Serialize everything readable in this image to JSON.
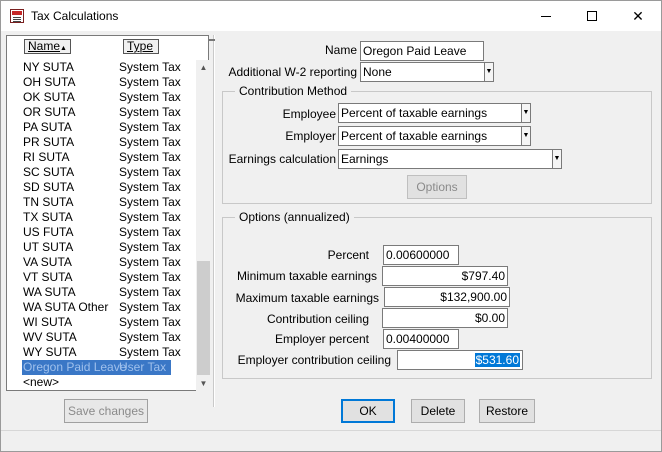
{
  "window": {
    "title": "Tax Calculations"
  },
  "list": {
    "col_name": "Name",
    "col_type": "Type",
    "rows": [
      {
        "name": "NY SUTA",
        "type": "System Tax"
      },
      {
        "name": "OH SUTA",
        "type": "System Tax"
      },
      {
        "name": "OK SUTA",
        "type": "System Tax"
      },
      {
        "name": "OR SUTA",
        "type": "System Tax"
      },
      {
        "name": "PA SUTA",
        "type": "System Tax"
      },
      {
        "name": "PR SUTA",
        "type": "System Tax"
      },
      {
        "name": "RI SUTA",
        "type": "System Tax"
      },
      {
        "name": "SC SUTA",
        "type": "System Tax"
      },
      {
        "name": "SD SUTA",
        "type": "System Tax"
      },
      {
        "name": "TN SUTA",
        "type": "System Tax"
      },
      {
        "name": "TX SUTA",
        "type": "System Tax"
      },
      {
        "name": "US FUTA",
        "type": "System Tax"
      },
      {
        "name": "UT SUTA",
        "type": "System Tax"
      },
      {
        "name": "VA SUTA",
        "type": "System Tax"
      },
      {
        "name": "VT SUTA",
        "type": "System Tax"
      },
      {
        "name": "WA SUTA",
        "type": "System Tax"
      },
      {
        "name": "WA SUTA Other",
        "type": "System Tax"
      },
      {
        "name": "WI SUTA",
        "type": "System Tax"
      },
      {
        "name": "WV SUTA",
        "type": "System Tax"
      },
      {
        "name": "WY SUTA",
        "type": "System Tax"
      },
      {
        "name": "Oregon Paid Leave",
        "type": "User Tax"
      }
    ],
    "new_item": "<new>",
    "save_button": "Save changes"
  },
  "form": {
    "name_label": "Name",
    "name_value": "Oregon Paid Leave",
    "w2_label": "Additional W-2 reporting",
    "w2_value": "None",
    "contribution": {
      "title": "Contribution Method",
      "employee_label": "Employee",
      "employee_value": "Percent of taxable earnings",
      "employer_label": "Employer",
      "employer_value": "Percent of taxable earnings",
      "earnings_label": "Earnings calculation",
      "earnings_value": "Earnings",
      "options_button": "Options"
    },
    "options": {
      "title": "Options (annualized)",
      "percent_label": "Percent",
      "percent_value": "0.00600000",
      "min_label": "Minimum taxable earnings",
      "min_value": "$797.40",
      "max_label": "Maximum taxable earnings",
      "max_value": "$132,900.00",
      "ceiling_label": "Contribution ceiling",
      "ceiling_value": "$0.00",
      "emp_pct_label": "Employer percent",
      "emp_pct_value": "0.00400000",
      "emp_ceiling_label": "Employer contribution ceiling",
      "emp_ceiling_value": "$531.60"
    },
    "ok_button": "OK",
    "delete_button": "Delete",
    "restore_button": "Restore"
  }
}
